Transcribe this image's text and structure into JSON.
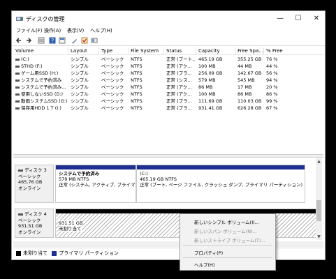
{
  "window": {
    "title": "ディスクの管理",
    "minimize_glyph": "—",
    "maximize_glyph": "☐",
    "close_glyph": "✕"
  },
  "menu": [
    "ファイル(F)",
    "操作(A)",
    "表示(V)",
    "ヘルプ(H)"
  ],
  "toolbar_icons": [
    "back-icon",
    "forward-icon",
    "disk-list-icon",
    "help-icon",
    "properties-icon",
    "edit-icon",
    "check-icon",
    "view-icon"
  ],
  "volume_table": {
    "headers": [
      "Volume",
      "Layout",
      "Type",
      "File System",
      "Status",
      "Capacity",
      "Free Spa...",
      "% Free"
    ],
    "rows": [
      [
        "(C:)",
        "シンプル",
        "ベーシック",
        "NTFS",
        "正常 (ブート...",
        "465.19 GB",
        "355.25 GB",
        "76 %"
      ],
      [
        "STHD (F:)",
        "シンプル",
        "ベーシック",
        "NTFS",
        "正常 (アク...",
        "100 MB",
        "44 MB",
        "44 %"
      ],
      [
        "ゲーム用SSD (H:)",
        "シンプル",
        "ベーシック",
        "NTFS",
        "正常 (プラ...",
        "256.09 GB",
        "142.67 GB",
        "56 %"
      ],
      [
        "システムで予約済み",
        "シンプル",
        "ベーシック",
        "NTFS",
        "正常 (シス...",
        "579 MB",
        "545 MB",
        "94 %"
      ],
      [
        "システムで予約済み...",
        "シンプル",
        "ベーシック",
        "NTFS",
        "正常 (アク...",
        "86 MB",
        "17 MB",
        "20 %"
      ],
      [
        "使用しないSSD (D:)",
        "シンプル",
        "ベーシック",
        "NTFS",
        "正常 (アク...",
        "100 MB",
        "86 MB",
        "86 %"
      ],
      [
        "動画システムSSD (G:)",
        "シンプル",
        "ベーシック",
        "NTFS",
        "正常 (プラ...",
        "111.69 GB",
        "110.03 GB",
        "99 %"
      ],
      [
        "保存用HDD 1 T (I:)",
        "シンプル",
        "ベーシック",
        "NTFS",
        "正常 (プラ...",
        "931.41 GB",
        "626.28 GB",
        "67 %"
      ]
    ]
  },
  "disks": {
    "disk3": {
      "name": "ディスク 3",
      "type": "ベーシック",
      "size": "465.76 GB",
      "status": "オンライン",
      "partitions": [
        {
          "name": "システムで予約済み",
          "size": "579 MB NTFS",
          "status": "正常 (システム, アクティブ, プライマリ パ"
        },
        {
          "name": "(C:)",
          "size": "465.19 GB NTFS",
          "status": "正常 (ブート, ページ ファイル, クラッシュ ダンプ, プライマリ パーティション)"
        }
      ]
    },
    "disk4": {
      "name": "ディスク 4",
      "type": "ベーシック",
      "size": "931.51 GB",
      "status": "オンライン",
      "unallocated_size": "931.51 GB",
      "unallocated_label": "未割り当て"
    }
  },
  "legend": {
    "unallocated": "未割り当て",
    "primary": "プライマリ パーティション",
    "unallocated_color": "#000000",
    "primary_color": "#1f2f8f"
  },
  "context_menu": {
    "items": [
      {
        "label": "新しいシンプル ボリューム(I)...",
        "enabled": true
      },
      {
        "label": "新しいスパン ボリューム(N)...",
        "enabled": false
      },
      {
        "label": "新しいストライプ ボリューム(T)...",
        "enabled": false
      },
      {
        "label": "プロパティ(P)",
        "enabled": true
      },
      {
        "label": "ヘルプ(H)",
        "enabled": true
      }
    ]
  }
}
